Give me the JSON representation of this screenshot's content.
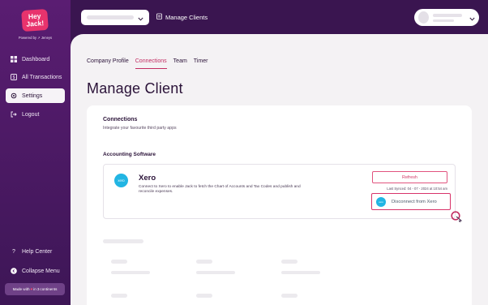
{
  "brand": {
    "logo_line1": "Hey",
    "logo_line2": "Jack!",
    "powered_by": "Powered by ↗ Jeneys"
  },
  "sidebar": {
    "items": [
      {
        "label": "Dashboard",
        "icon": "dashboard-icon"
      },
      {
        "label": "All Transactions",
        "icon": "transactions-icon"
      },
      {
        "label": "Settings",
        "icon": "gear-icon",
        "active": true
      },
      {
        "label": "Logout",
        "icon": "logout-icon"
      }
    ],
    "help": "Help Center",
    "collapse": "Collapse Menu",
    "made_with_pre": "Made with",
    "made_with_post": "in",
    "continents_count": "3",
    "continents": "continents"
  },
  "header": {
    "manage_clients": "Manage Clients"
  },
  "main": {
    "tabs": [
      {
        "label": "Company Profile"
      },
      {
        "label": "Connections",
        "active": true
      },
      {
        "label": "Team"
      },
      {
        "label": "Timer"
      }
    ],
    "title": "Manage Client",
    "connections_heading": "Connections",
    "connections_sub": "Integrate your favourite third party apps",
    "accounting_heading": "Accounting Software",
    "xero": {
      "logo_text": "xero",
      "name": "Xero",
      "description": "Connect to Xero to enable Jack to fetch the Chart of Accounts and Tax Codes and publish and reconcile expenses.",
      "refresh_label": "Refresh",
      "last_synced": "Last Synced: 04 - 07 - 2024 at 10:54 am",
      "disconnect_label": "Disconnect from Xero"
    }
  },
  "colors": {
    "sidebar": "#5a1d72",
    "accent": "#c22d62",
    "xero": "#22b5e3",
    "logo": "#e8336d"
  }
}
